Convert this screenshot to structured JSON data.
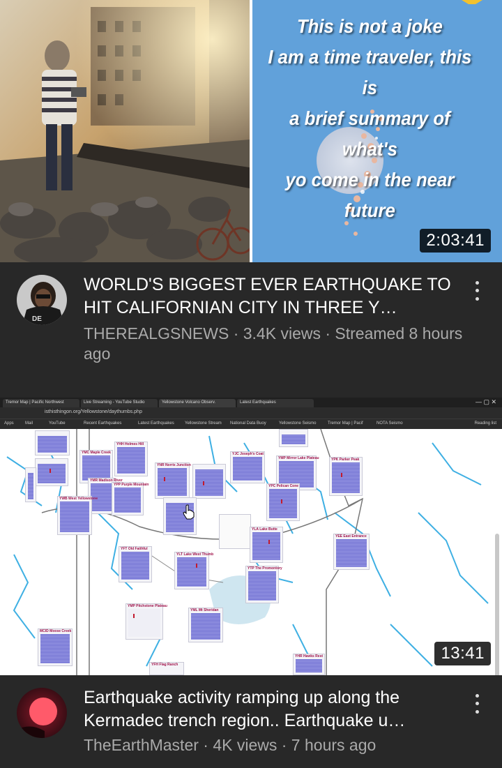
{
  "videos": [
    {
      "thumbnail": {
        "overlay_lines": [
          "This is not a joke",
          "I am a time traveler, this is",
          "a brief summary of what's",
          "yo come in the near future"
        ]
      },
      "duration": "2:03:41",
      "title": "WORLD'S BIGGEST EVER EARTHQUAKE TO HIT CALIFORNIAN CITY IN THREE Y…",
      "channel": "THEREALGSNEWS",
      "views": "3.4K views",
      "age": "Streamed 8 hours ago",
      "subline": "THEREALGSNEWS · 3.4K views · Streamed 8 hours ago",
      "avatar_text": "DE"
    },
    {
      "thumbnail": {
        "browser": {
          "url": "isthisthingon.org/Yellowstone/daythumbs.php",
          "tabs": [
            "Tremor Map | Pacific Northwest",
            "Live Streaming - YouTube Studio",
            "Yellowstone Volcano Observ.",
            "Latest Earthquakes"
          ],
          "bookmarks": [
            "Apps",
            "Mail",
            "YouTube",
            "Recent Earthquakes",
            "Latest Earthquakes",
            "Yellowstone Stream",
            "National Data Buoy",
            "Yellowstone Seismo",
            "Tremor Map | Pacif",
            "NOTA Seismo"
          ],
          "reading_list": "Reading list"
        },
        "stations": [
          "MCID Moose Creek",
          "YMP Pitchstone Plateau",
          "YML Mt Sheridan",
          "YFT Old Faithful",
          "YLT Lake West Thumb",
          "YTP The Promontory",
          "YLA Lake Butte",
          "YEE East Entrance",
          "YPC Pelican Cone",
          "YNR Norris Junction",
          "YHH Holmes Hill",
          "YJC Joseph's Coat",
          "YMP Mirror Lake Plateau",
          "YPK Parker Peak",
          "YMC Maple Creek",
          "YWB West Yellowstone",
          "YDD Daisy Basin",
          "YFH Flag Ranch",
          "YHR Hawks Rest",
          "YMR Madison River",
          "YGC Gardner",
          "YPP Purple Mountain"
        ]
      },
      "duration": "13:41",
      "title": "Earthquake activity ramping up along the Kermadec trench region.. Earthquake u…",
      "channel": "TheEarthMaster",
      "views": "4K views",
      "age": "7 hours ago",
      "subline": "TheEarthMaster · 4K views · 7 hours ago"
    }
  ],
  "colors": {
    "background": "#282828",
    "title_text": "#ffffff",
    "meta_text": "#aaaaaa"
  }
}
